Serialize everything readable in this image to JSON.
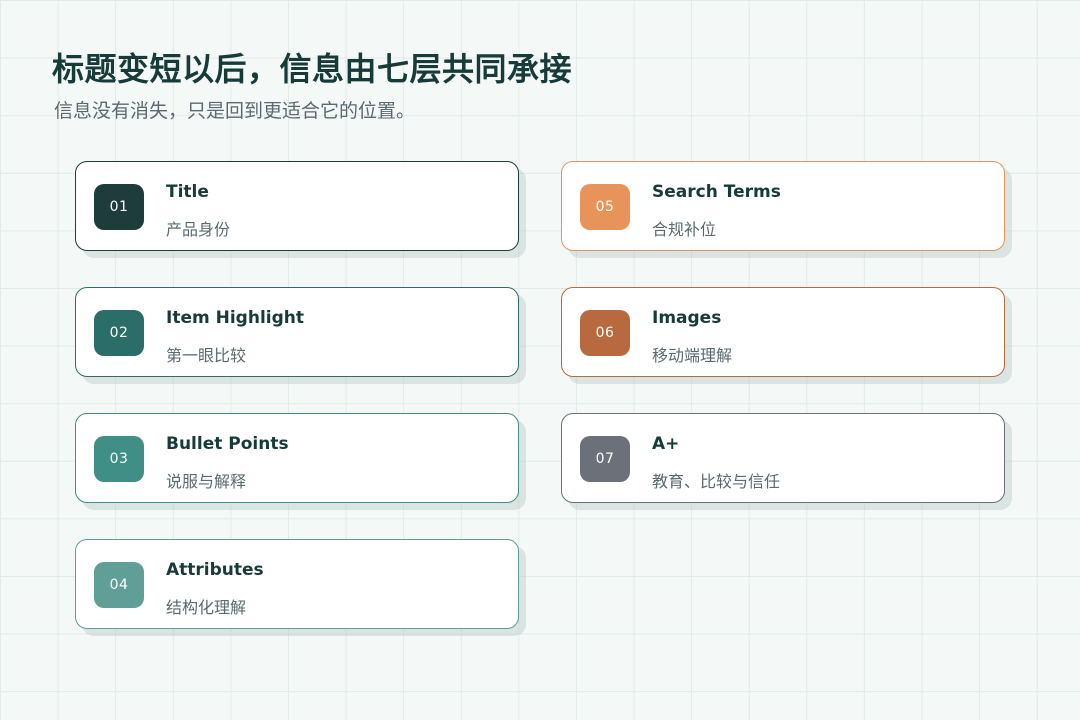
{
  "header": {
    "title": "标题变短以后，信息由七层共同承接",
    "subtitle": "信息没有消失，只是回到更适合它的位置。"
  },
  "cards": [
    {
      "number": "01",
      "title": "Title",
      "desc": "产品身份",
      "color": "#1d3c3a"
    },
    {
      "number": "02",
      "title": "Item Highlight",
      "desc": "第一眼比较",
      "color": "#2b6d68"
    },
    {
      "number": "03",
      "title": "Bullet Points",
      "desc": "说服与解释",
      "color": "#3f8f87"
    },
    {
      "number": "04",
      "title": "Attributes",
      "desc": "结构化理解",
      "color": "#5f9f98"
    },
    {
      "number": "05",
      "title": "Search Terms",
      "desc": "合规补位",
      "color": "#e8935a"
    },
    {
      "number": "06",
      "title": "Images",
      "desc": "移动端理解",
      "color": "#b8693d"
    },
    {
      "number": "07",
      "title": "A+",
      "desc": "教育、比较与信任",
      "color": "#6b7079"
    }
  ]
}
